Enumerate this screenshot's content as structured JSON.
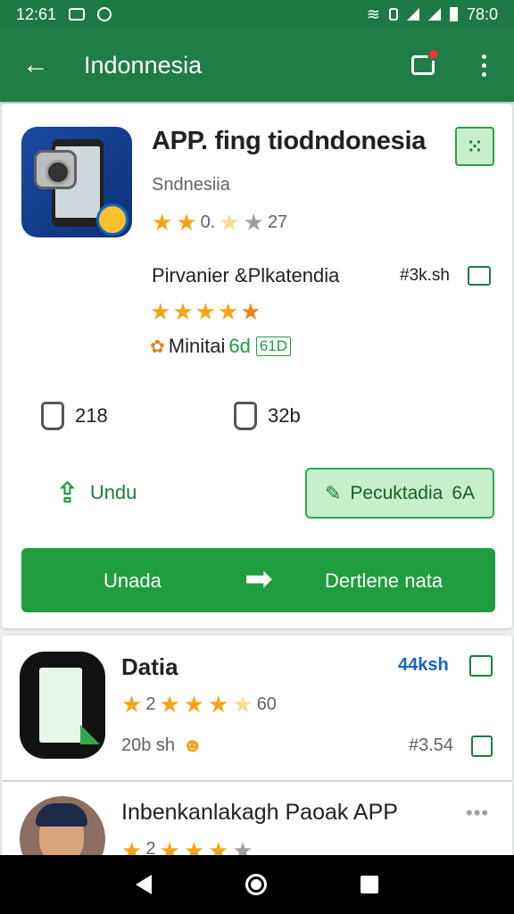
{
  "status_bar": {
    "time": "12:61",
    "right_time": "78:0"
  },
  "app_bar": {
    "back_icon": "arrow-left-icon",
    "title": "Indonnesia",
    "notification_icon": "message-badge-icon",
    "more_icon": "overflow-menu-icon"
  },
  "featured_app": {
    "title": "APP. fing tiodndonesia",
    "subtitle": "Sndnesiia",
    "rating_text": "0.",
    "rating_count": "27",
    "developer": "Pirvanier &Plkatendia",
    "developer_meta": "#3k.sh",
    "developer_stars": 4.5,
    "minit_label": "Minitai",
    "minit_badge": "6d",
    "minit_badge_box": "61D",
    "stat1": "218",
    "stat2": "32b",
    "download_label": "Undu",
    "edit_label": "Pecuktadia",
    "edit_suffix": "6A",
    "main_left": "Unada",
    "main_right": "Dertlene nata",
    "qr_icon": "qr-code-icon",
    "accent": "#1f9d3f"
  },
  "list_items": [
    {
      "title": "Datia",
      "rating_number": "2",
      "rating_count": "60",
      "size": "20b sh",
      "price": "44ksh",
      "price2": "#3.54"
    },
    {
      "title": "Inbenkanlakagh Paoak APP",
      "rating_number": "2",
      "more_icon": "more-horizontal-icon"
    }
  ],
  "nav": {
    "back": "nav-back-icon",
    "home": "nav-home-icon",
    "recents": "nav-recents-icon"
  }
}
